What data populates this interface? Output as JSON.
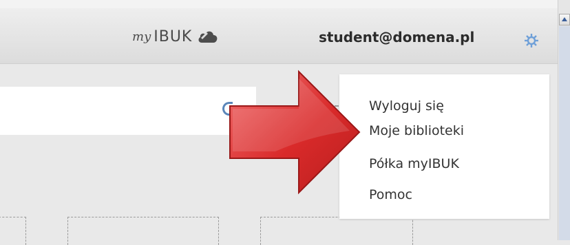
{
  "header": {
    "brand_prefix": "my",
    "brand_name": "IBUK",
    "user_email": "student@domena.pl"
  },
  "icons": {
    "brand": "cloud-icon",
    "settings": "gear-icon",
    "search": "search-icon"
  },
  "user_menu": {
    "items": [
      {
        "label": "Wyloguj się"
      },
      {
        "label": "Moje biblioteki"
      },
      {
        "label": "Półka myIBUK"
      },
      {
        "label": "Pomoc"
      }
    ]
  },
  "colors": {
    "arrow": "#d92a2a",
    "accent": "#5a86b9",
    "gear": "#6fa0d8"
  }
}
